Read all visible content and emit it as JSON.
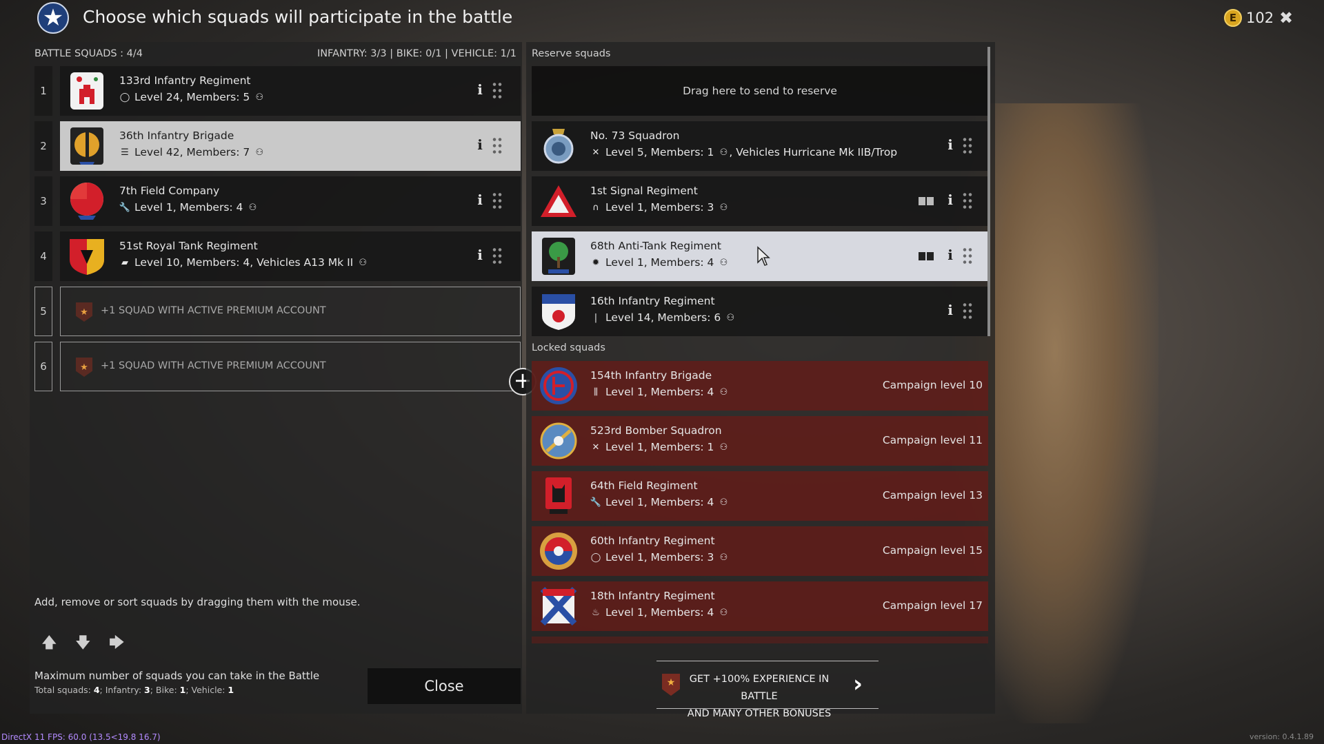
{
  "header": {
    "title": "Choose which squads will participate in the battle",
    "currency_symbol": "E",
    "currency_value": "102",
    "close_symbol": "✖"
  },
  "battle": {
    "label": "BATTLE SQUADS : 4/4",
    "counts": "INFANTRY: 3/3 | BIKE: 0/1 | VEHICLE: 1/1",
    "squads": [
      {
        "num": "1",
        "name": "133rd Infantry Regiment",
        "sub": "Level 24, Members: 5",
        "icon": "target-icon"
      },
      {
        "num": "2",
        "name": "36th Infantry Brigade",
        "sub": "Level 42, Members: 7",
        "icon": "list-icon"
      },
      {
        "num": "3",
        "name": "7th Field Company",
        "sub": "Level 1, Members: 4",
        "icon": "wrench-icon"
      },
      {
        "num": "4",
        "name": "51st Royal Tank Regiment",
        "sub": "Level 10, Members: 4, Vehicles A13 Mk II",
        "icon": "tank-icon"
      }
    ],
    "premium_slots": [
      {
        "num": "5",
        "text": "+1 SQUAD WITH ACTIVE PREMIUM ACCOUNT"
      },
      {
        "num": "6",
        "text": "+1 SQUAD WITH ACTIVE PREMIUM ACCOUNT"
      }
    ],
    "hint": "Add, remove or sort squads by dragging them with the mouse.",
    "max_title": "Maximum number of squads you can take in the Battle",
    "max_sub_parts": {
      "total_label": "Total squads: ",
      "total": "4",
      "infantry_label": "; Infantry: ",
      "infantry": "3",
      "bike_label": "; Bike: ",
      "bike": "1",
      "vehicle_label": "; Vehicle: ",
      "vehicle": "1"
    },
    "close_label": "Close"
  },
  "reserve": {
    "label": "Reserve squads",
    "drop_text": "Drag here to send to reserve",
    "squads": [
      {
        "name": "No. 73 Squadron",
        "sub": "Level 5, Members: 1",
        "extra": ", Vehicles Hurricane Mk IIB/Trop",
        "icon": "plane-icon"
      },
      {
        "name": "1st Signal Regiment",
        "sub": "Level 1, Members: 3",
        "icon": "headphones-icon"
      },
      {
        "name": "68th Anti-Tank Regiment",
        "sub": "Level 1, Members: 4",
        "icon": "explosion-icon"
      },
      {
        "name": "16th Infantry Regiment",
        "sub": "Level 14, Members: 6",
        "icon": "rifle-icon"
      }
    ]
  },
  "locked": {
    "label": "Locked squads",
    "squads": [
      {
        "name": "154th Infantry Brigade",
        "sub": "Level 1, Members: 4",
        "level": "Campaign level 10",
        "icon": "ammo-icon"
      },
      {
        "name": "523rd Bomber Squadron",
        "sub": "Level 1, Members: 1",
        "level": "Campaign level 11",
        "icon": "plane-icon"
      },
      {
        "name": "64th Field Regiment",
        "sub": "Level 1, Members: 4",
        "level": "Campaign level 13",
        "icon": "wrench-icon"
      },
      {
        "name": "60th Infantry Regiment",
        "sub": "Level 1, Members: 3",
        "level": "Campaign level 15",
        "icon": "target-icon"
      },
      {
        "name": "18th Infantry Regiment",
        "sub": "Level 1, Members: 4",
        "level": "Campaign level 17",
        "icon": "flame-icon"
      }
    ]
  },
  "promo": {
    "line1": "GET +100% EXPERIENCE IN BATTLE",
    "line2": "AND MANY OTHER BONUSES"
  },
  "footer": {
    "debug": "DirectX 11 FPS: 60.0 (13.5<19.8 16.7)",
    "version": "version: 0.4.1.89"
  },
  "colors": {
    "selected_row": "#c9c9c9",
    "hover_row": "#d7d9e0",
    "locked_row": "#64181a",
    "debug_text": "#b38bff"
  }
}
